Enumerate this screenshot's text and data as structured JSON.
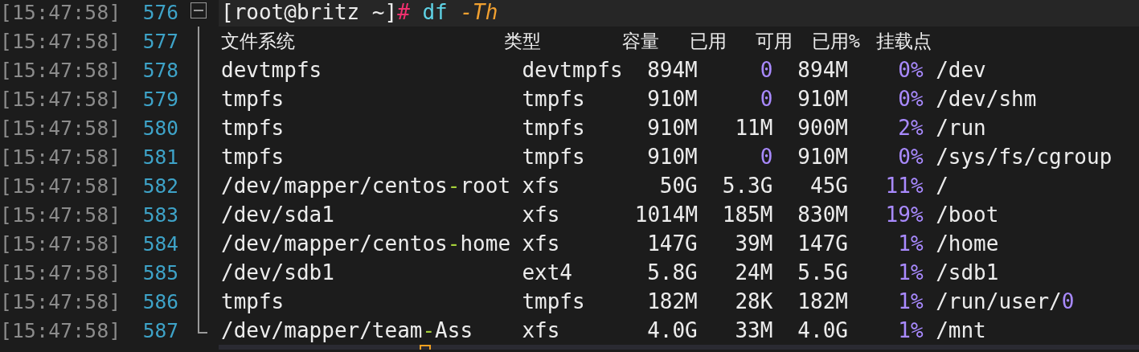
{
  "block": {
    "time": "[15:47:58]",
    "number": "576",
    "expanded": true,
    "command": [
      {
        "text": "[root@britz ~]",
        "kind": "plain"
      },
      {
        "text": "# ",
        "kind": "hash"
      },
      {
        "text": "df ",
        "kind": "command"
      },
      {
        "text": "-Th",
        "kind": "flag"
      }
    ],
    "children": [
      {
        "time": "[15:47:58]",
        "number": "577",
        "kind": "header",
        "cells": [
          "文件系统",
          "类型",
          "容量",
          "已用",
          "可用",
          "已用%",
          "挂载点"
        ]
      },
      {
        "time": "[15:47:58]",
        "number": "578",
        "kind": "row",
        "cells": [
          [
            {
              "text": "devtmpfs",
              "kind": "plain"
            }
          ],
          [
            {
              "text": "devtmpfs",
              "kind": "plain"
            }
          ],
          [
            {
              "text": "894M",
              "kind": "plain"
            }
          ],
          [
            {
              "text": "0",
              "kind": "number"
            }
          ],
          [
            {
              "text": "894M",
              "kind": "plain"
            }
          ],
          [
            {
              "text": "0%",
              "kind": "number"
            }
          ],
          [
            {
              "text": "/dev",
              "kind": "plain"
            }
          ]
        ]
      },
      {
        "time": "[15:47:58]",
        "number": "579",
        "kind": "row",
        "cells": [
          [
            {
              "text": "tmpfs",
              "kind": "plain"
            }
          ],
          [
            {
              "text": "tmpfs",
              "kind": "plain"
            }
          ],
          [
            {
              "text": "910M",
              "kind": "plain"
            }
          ],
          [
            {
              "text": "0",
              "kind": "number"
            }
          ],
          [
            {
              "text": "910M",
              "kind": "plain"
            }
          ],
          [
            {
              "text": "0%",
              "kind": "number"
            }
          ],
          [
            {
              "text": "/dev/shm",
              "kind": "plain"
            }
          ]
        ]
      },
      {
        "time": "[15:47:58]",
        "number": "580",
        "kind": "row",
        "cells": [
          [
            {
              "text": "tmpfs",
              "kind": "plain"
            }
          ],
          [
            {
              "text": "tmpfs",
              "kind": "plain"
            }
          ],
          [
            {
              "text": "910M",
              "kind": "plain"
            }
          ],
          [
            {
              "text": "11M",
              "kind": "plain"
            }
          ],
          [
            {
              "text": "900M",
              "kind": "plain"
            }
          ],
          [
            {
              "text": "2%",
              "kind": "number"
            }
          ],
          [
            {
              "text": "/run",
              "kind": "plain"
            }
          ]
        ]
      },
      {
        "time": "[15:47:58]",
        "number": "581",
        "kind": "row",
        "cells": [
          [
            {
              "text": "tmpfs",
              "kind": "plain"
            }
          ],
          [
            {
              "text": "tmpfs",
              "kind": "plain"
            }
          ],
          [
            {
              "text": "910M",
              "kind": "plain"
            }
          ],
          [
            {
              "text": "0",
              "kind": "number"
            }
          ],
          [
            {
              "text": "910M",
              "kind": "plain"
            }
          ],
          [
            {
              "text": "0%",
              "kind": "number"
            }
          ],
          [
            {
              "text": "/sys/fs/cgroup",
              "kind": "plain"
            }
          ]
        ]
      },
      {
        "time": "[15:47:58]",
        "number": "582",
        "kind": "row",
        "cells": [
          [
            {
              "text": "/dev/mapper/centos",
              "kind": "plain"
            },
            {
              "text": "-",
              "kind": "operator"
            },
            {
              "text": "root",
              "kind": "plain"
            }
          ],
          [
            {
              "text": "xfs",
              "kind": "plain"
            }
          ],
          [
            {
              "text": "50G",
              "kind": "plain"
            }
          ],
          [
            {
              "text": "5.3G",
              "kind": "plain"
            }
          ],
          [
            {
              "text": "45G",
              "kind": "plain"
            }
          ],
          [
            {
              "text": "11%",
              "kind": "number"
            }
          ],
          [
            {
              "text": "/",
              "kind": "plain"
            }
          ]
        ]
      },
      {
        "time": "[15:47:58]",
        "number": "583",
        "kind": "row",
        "cells": [
          [
            {
              "text": "/dev/sda1",
              "kind": "plain"
            }
          ],
          [
            {
              "text": "xfs",
              "kind": "plain"
            }
          ],
          [
            {
              "text": "1014M",
              "kind": "plain"
            }
          ],
          [
            {
              "text": "185M",
              "kind": "plain"
            }
          ],
          [
            {
              "text": "830M",
              "kind": "plain"
            }
          ],
          [
            {
              "text": "19%",
              "kind": "number"
            }
          ],
          [
            {
              "text": "/boot",
              "kind": "plain"
            }
          ]
        ]
      },
      {
        "time": "[15:47:58]",
        "number": "584",
        "kind": "row",
        "cells": [
          [
            {
              "text": "/dev/mapper/centos",
              "kind": "plain"
            },
            {
              "text": "-",
              "kind": "operator"
            },
            {
              "text": "home",
              "kind": "plain"
            }
          ],
          [
            {
              "text": "xfs",
              "kind": "plain"
            }
          ],
          [
            {
              "text": "147G",
              "kind": "plain"
            }
          ],
          [
            {
              "text": "39M",
              "kind": "plain"
            }
          ],
          [
            {
              "text": "147G",
              "kind": "plain"
            }
          ],
          [
            {
              "text": "1%",
              "kind": "number"
            }
          ],
          [
            {
              "text": "/home",
              "kind": "plain"
            }
          ]
        ]
      },
      {
        "time": "[15:47:58]",
        "number": "585",
        "kind": "row",
        "cells": [
          [
            {
              "text": "/dev/sdb1",
              "kind": "plain"
            }
          ],
          [
            {
              "text": "ext4",
              "kind": "plain"
            }
          ],
          [
            {
              "text": "5.8G",
              "kind": "plain"
            }
          ],
          [
            {
              "text": "24M",
              "kind": "plain"
            }
          ],
          [
            {
              "text": "5.5G",
              "kind": "plain"
            }
          ],
          [
            {
              "text": "1%",
              "kind": "number"
            }
          ],
          [
            {
              "text": "/sdb1",
              "kind": "plain"
            }
          ]
        ]
      },
      {
        "time": "[15:47:58]",
        "number": "586",
        "kind": "row",
        "cells": [
          [
            {
              "text": "tmpfs",
              "kind": "plain"
            }
          ],
          [
            {
              "text": "tmpfs",
              "kind": "plain"
            }
          ],
          [
            {
              "text": "182M",
              "kind": "plain"
            }
          ],
          [
            {
              "text": "28K",
              "kind": "plain"
            }
          ],
          [
            {
              "text": "182M",
              "kind": "plain"
            }
          ],
          [
            {
              "text": "1%",
              "kind": "number"
            }
          ],
          [
            {
              "text": "/run/user/",
              "kind": "plain"
            },
            {
              "text": "0",
              "kind": "number"
            }
          ]
        ]
      },
      {
        "time": "[15:47:58]",
        "number": "587",
        "kind": "row",
        "cells": [
          [
            {
              "text": "/dev/mapper/team",
              "kind": "plain"
            },
            {
              "text": "-",
              "kind": "operator"
            },
            {
              "text": "Ass",
              "kind": "plain"
            }
          ],
          [
            {
              "text": "xfs",
              "kind": "plain"
            }
          ],
          [
            {
              "text": "4.0G",
              "kind": "plain"
            }
          ],
          [
            {
              "text": "33M",
              "kind": "plain"
            }
          ],
          [
            {
              "text": "4.0G",
              "kind": "plain"
            }
          ],
          [
            {
              "text": "1%",
              "kind": "number"
            }
          ],
          [
            {
              "text": "/mnt",
              "kind": "plain"
            }
          ]
        ]
      }
    ]
  },
  "current_line": {
    "cursor": true
  }
}
